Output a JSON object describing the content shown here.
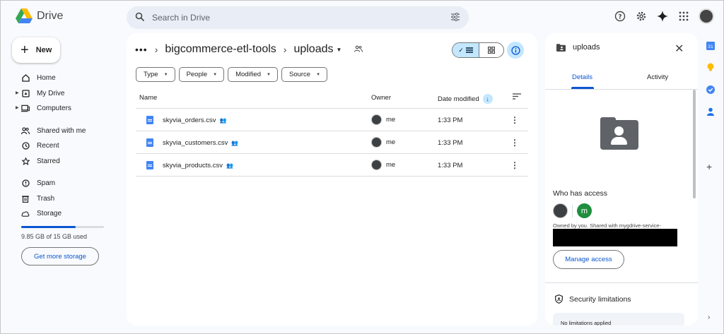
{
  "app": {
    "name": "Drive"
  },
  "search": {
    "placeholder": "Search in Drive"
  },
  "new_button": {
    "label": "New"
  },
  "sidebar": {
    "items": [
      {
        "label": "Home",
        "icon": "home-icon"
      },
      {
        "label": "My Drive",
        "icon": "my-drive-icon"
      },
      {
        "label": "Computers",
        "icon": "computers-icon"
      },
      {
        "label": "Shared with me",
        "icon": "shared-icon"
      },
      {
        "label": "Recent",
        "icon": "clock-icon"
      },
      {
        "label": "Starred",
        "icon": "star-icon"
      },
      {
        "label": "Spam",
        "icon": "spam-icon"
      },
      {
        "label": "Trash",
        "icon": "trash-icon"
      },
      {
        "label": "Storage",
        "icon": "cloud-icon"
      }
    ],
    "storage_text": "9.85 GB of 15 GB used",
    "storage_fraction": 0.657,
    "get_more_storage": "Get more storage"
  },
  "breadcrumb": {
    "dots": "•••",
    "parent": "bigcommerce-etl-tools",
    "current": "uploads"
  },
  "filters": [
    "Type",
    "People",
    "Modified",
    "Source"
  ],
  "table": {
    "headers": {
      "name": "Name",
      "owner": "Owner",
      "date_modified": "Date modified"
    },
    "rows": [
      {
        "name": "skyvia_orders.csv",
        "owner": "me",
        "modified": "1:33 PM"
      },
      {
        "name": "skyvia_customers.csv",
        "owner": "me",
        "modified": "1:33 PM"
      },
      {
        "name": "skyvia_products.csv",
        "owner": "me",
        "modified": "1:33 PM"
      }
    ]
  },
  "details": {
    "title": "uploads",
    "tabs": [
      "Details",
      "Activity"
    ],
    "who_has_access": "Who has access",
    "avatar_letter": "m",
    "owned_text": "Owned by you. Shared with mygdrive-service-",
    "manage_access": "Manage access",
    "security_title": "Security limitations",
    "security_status": "No limitations applied"
  },
  "colors": {
    "accent": "#0b57d0",
    "selected_bg": "#c2e7ff",
    "background": "#f8fafd"
  }
}
